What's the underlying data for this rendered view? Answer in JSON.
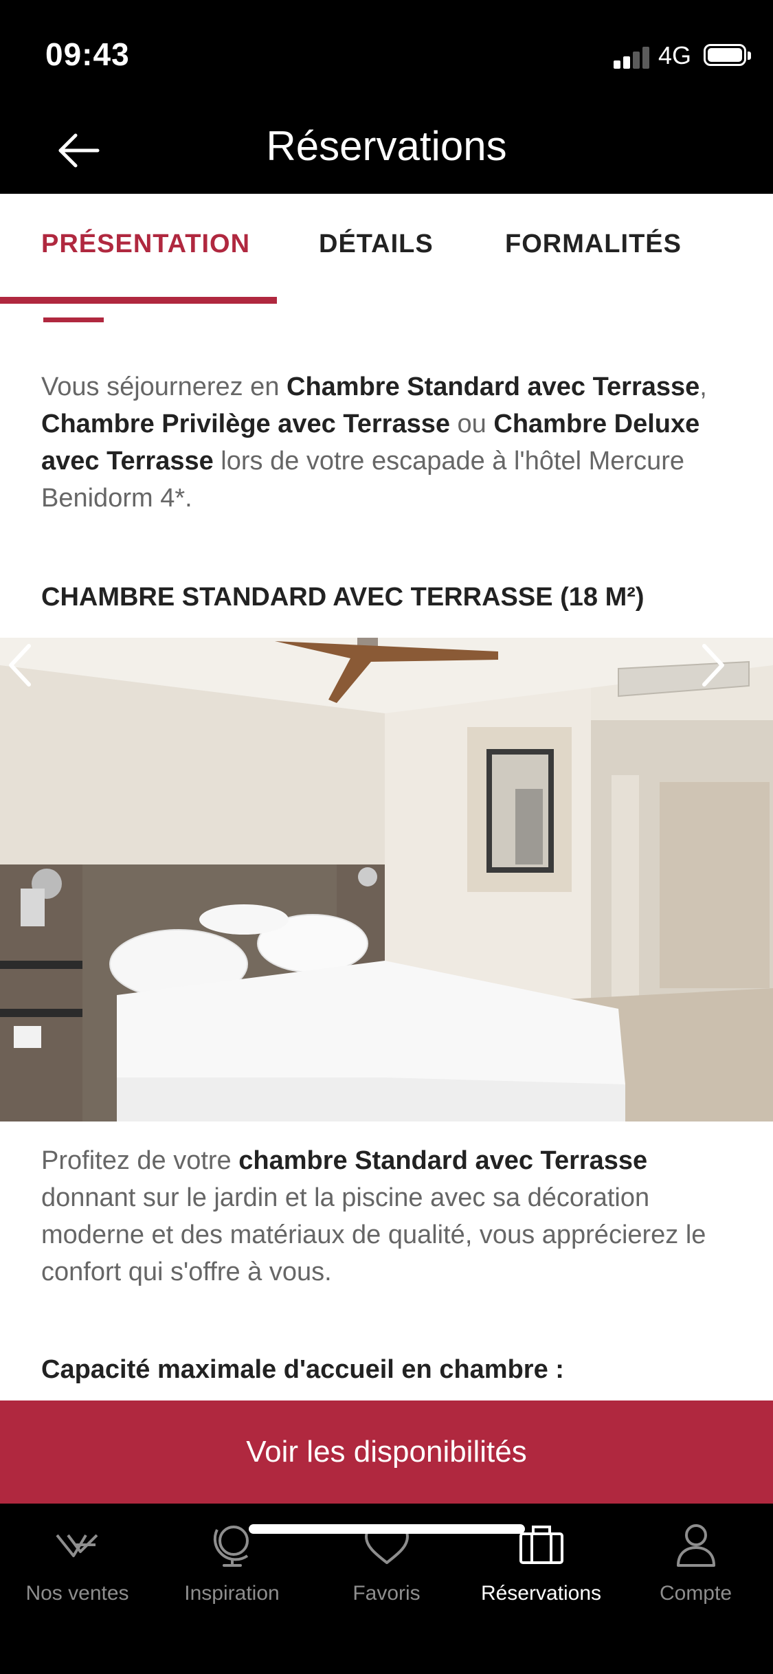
{
  "status_bar": {
    "time": "09:43",
    "network": "4G"
  },
  "header": {
    "title": "Réservations"
  },
  "tabs": [
    {
      "label": "PRÉSENTATION",
      "active": true
    },
    {
      "label": "DÉTAILS",
      "active": false
    },
    {
      "label": "FORMALITÉS",
      "active": false
    }
  ],
  "intro": {
    "p1": "Vous séjournerez en ",
    "b1": "Chambre Standard avec Terrasse",
    "p2": ",",
    "b2": "Chambre Privilège avec Terrasse",
    "p3": " ou ",
    "b3": "Chambre Deluxe avec Terrasse",
    "p4": " lors de votre escapade à l'hôtel Mercure Benidorm 4*."
  },
  "room": {
    "title": "CHAMBRE STANDARD AVEC TERRASSE (18 M²)",
    "desc_p1": "Profitez de votre ",
    "desc_b1": "chambre Standard avec Terrasse",
    "desc_p2": " donnant sur le jardin et la piscine avec sa décoration moderne et des matériaux de qualité, vous apprécierez le confort qui s'offre à vous."
  },
  "capacity": {
    "title": "Capacité maximale d'accueil en chambre :"
  },
  "cta": {
    "label": "Voir les disponibilités"
  },
  "bottom_nav": [
    {
      "label": "Nos ventes",
      "icon": "brand-logo-icon",
      "active": false
    },
    {
      "label": "Inspiration",
      "icon": "globe-icon",
      "active": false
    },
    {
      "label": "Favoris",
      "icon": "heart-icon",
      "active": false
    },
    {
      "label": "Réservations",
      "icon": "suitcase-icon",
      "active": true
    },
    {
      "label": "Compte",
      "icon": "user-icon",
      "active": false
    }
  ],
  "colors": {
    "accent": "#b0283f",
    "bar": "#000000",
    "text_muted": "#666666",
    "text_strong": "#222222"
  }
}
